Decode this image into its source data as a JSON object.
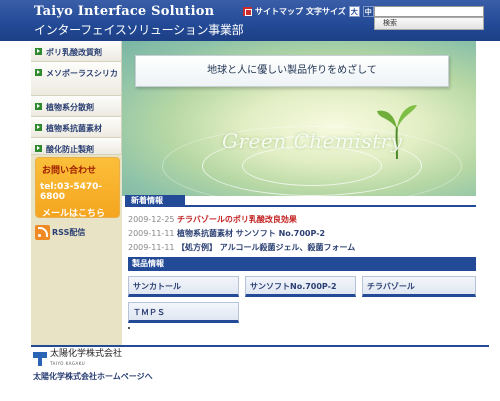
{
  "header": {
    "brand_en": "Taiyo Interface Solution",
    "brand_jp": "インターフェイスソリューション事業部",
    "sitemap_label": "サイトマップ",
    "text_size_label": "文字サイズ",
    "size_large": "大",
    "size_medium": "中",
    "size_small": "小",
    "search_placeholder": "",
    "search_button": "検索"
  },
  "sidebar": {
    "items": [
      {
        "label": "ポリ乳酸改質剤"
      },
      {
        "label": "メソポーラスシリカ"
      },
      {
        "label": "植物系分散剤"
      },
      {
        "label": "植物系抗菌素材"
      },
      {
        "label": "酸化防止製剤"
      }
    ],
    "contact": {
      "title": "お問い合わせ",
      "tel": "tel:03-5470-6800",
      "mail": "メールはこちら"
    },
    "rss": "RSS配信"
  },
  "hero": {
    "tagline": "地球と人に優しい製品作りをめざして",
    "watermark": "Green Chemistry"
  },
  "news": {
    "heading": "新着情報",
    "items": [
      {
        "date": "2009-12-25",
        "title": "チラバゾールのポリ乳酸改良効果",
        "highlight": true
      },
      {
        "date": "2009-11-11",
        "title": "植物系抗菌素材 サンソフト No.700P-2",
        "highlight": false
      },
      {
        "date": "2009-11-11",
        "title": "【処方例】 アルコール殺菌ジェル、殺菌フォーム",
        "highlight": false
      }
    ]
  },
  "products": {
    "heading": "製品情報",
    "items": [
      {
        "label": "サンカトール"
      },
      {
        "label": "サンソフトNo.700P-2"
      },
      {
        "label": "チラバゾール"
      },
      {
        "label": "ＴＭＰＳ"
      }
    ]
  },
  "footer": {
    "company_jp": "太陽化学株式会社",
    "company_en": "TAIYO KAGAKU",
    "home_link": "太陽化学株式会社ホームページへ"
  },
  "colors": {
    "brand_blue": "#234a96",
    "contact_orange": "#f5a51f",
    "news_highlight": "#c21f1f",
    "sidebar_bg": "#e7e3c4"
  }
}
